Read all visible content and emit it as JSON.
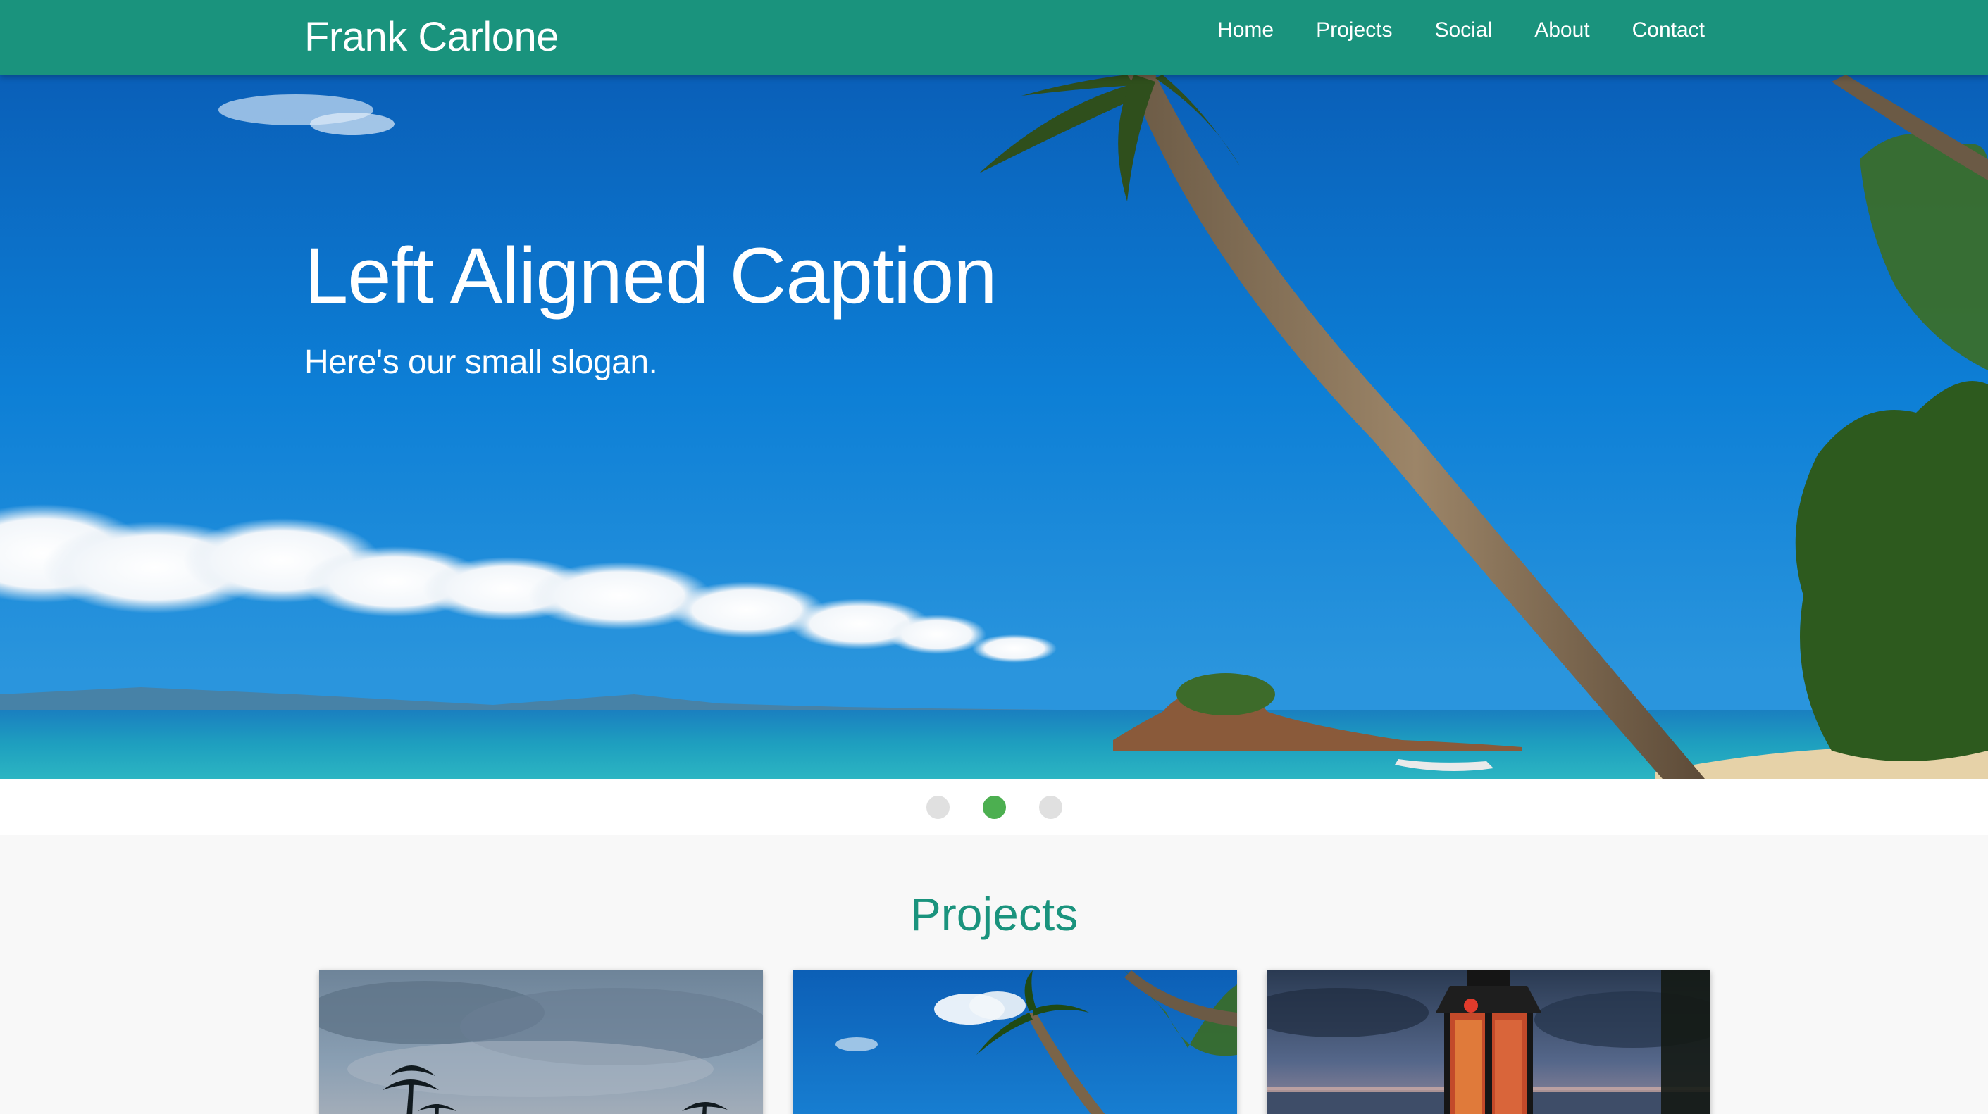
{
  "navbar": {
    "brand": "Frank Carlone",
    "links": [
      {
        "label": "Home"
      },
      {
        "label": "Projects"
      },
      {
        "label": "Social"
      },
      {
        "label": "About"
      },
      {
        "label": "Contact"
      }
    ],
    "background_color": "#1a937d"
  },
  "hero": {
    "title": "Left Aligned Caption",
    "slogan": "Here's our small slogan.",
    "image": "tropical-beach-palm-tree-photo",
    "active_slide_index": 1,
    "slide_count": 3,
    "indicator_active_color": "#4caf50",
    "indicator_inactive_color": "#e0e0e0"
  },
  "projects": {
    "heading": "Projects",
    "heading_color": "#1a937d",
    "cards": [
      {
        "image": "palm-trees-dusk-sky-photo"
      },
      {
        "image": "palm-tree-blue-sky-photo"
      },
      {
        "image": "lantern-at-dusk-photo"
      }
    ]
  }
}
